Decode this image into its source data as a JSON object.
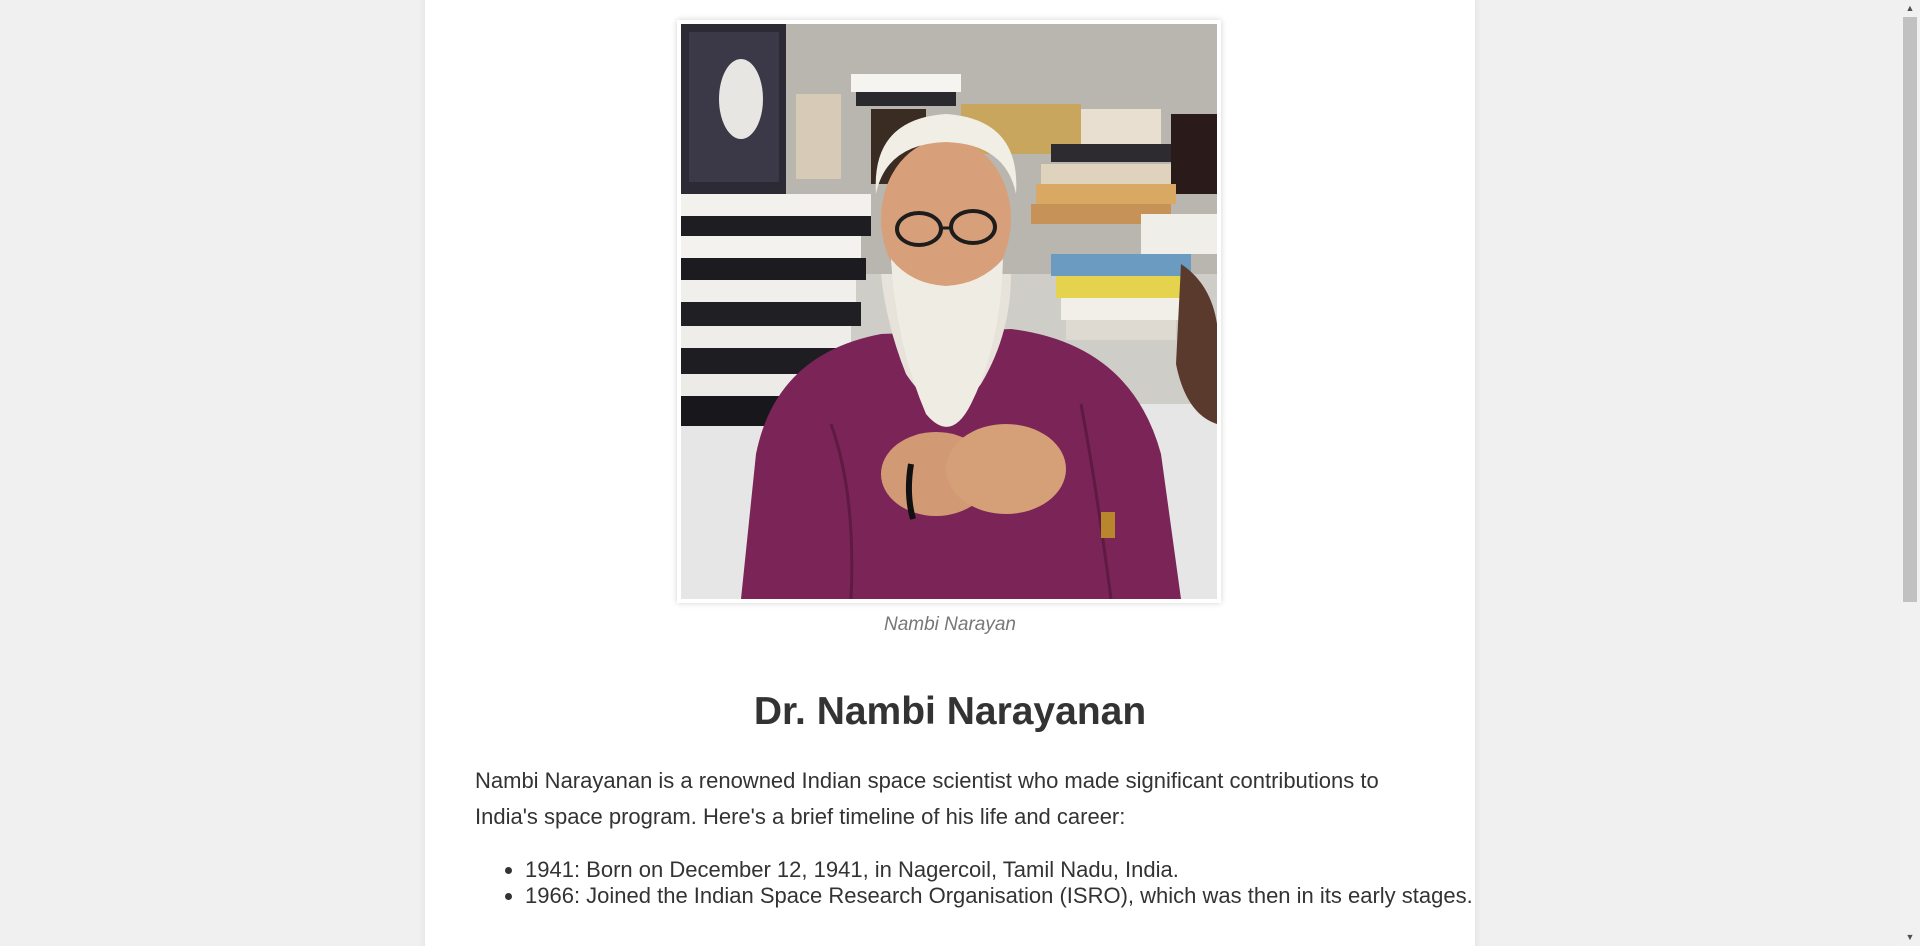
{
  "figure": {
    "caption": "Nambi Narayan"
  },
  "article": {
    "title": "Dr. Nambi Narayanan",
    "intro": "Nambi Narayanan is a renowned Indian space scientist who made significant contributions to India's space program. Here's a brief timeline of his life and career:",
    "timeline": [
      "1941: Born on December 12, 1941, in Nagercoil, Tamil Nadu, India.",
      "1966: Joined the Indian Space Research Organisation (ISRO), which was then in its early stages."
    ]
  },
  "scrollbar": {
    "up_icon": "triangle-up",
    "down_icon": "triangle-down"
  },
  "colors": {
    "background": "#f0f0f0",
    "card": "#ffffff",
    "text": "#333333",
    "caption": "#777777",
    "shirt": "#7b2457"
  }
}
